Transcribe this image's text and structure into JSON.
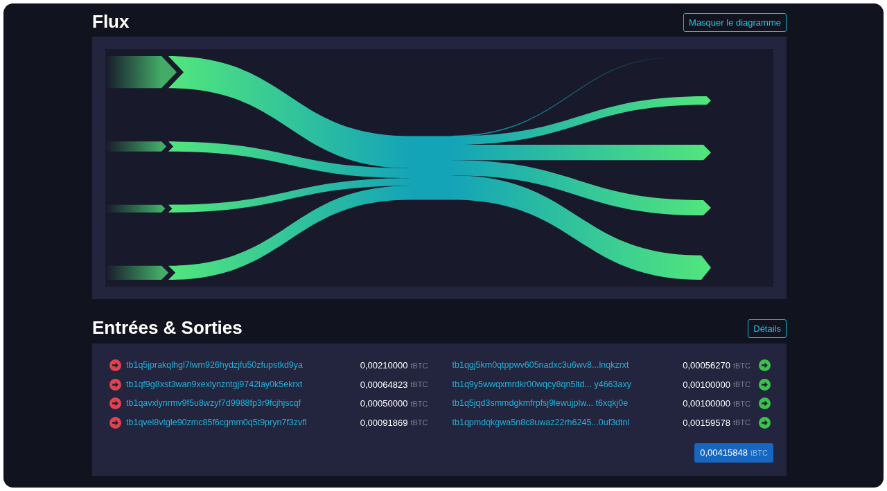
{
  "flow_section": {
    "title": "Flux",
    "toggle_button": "Masquer le diagramme"
  },
  "io_section": {
    "title": "Entrées & Sorties",
    "details_button": "Détails",
    "inputs": [
      {
        "address": "tb1q5jprakqlhgl7lwm926hydzjfu50zfupstkd9ya",
        "amount": "0,00210000",
        "unit": "tBTC"
      },
      {
        "address": "tb1qf9g8xst3wan9xexlynzntgj9742lay0k5ekrxt",
        "amount": "0,00064823",
        "unit": "tBTC"
      },
      {
        "address": "tb1qavxlynrmv9f5u8wzyf7d9988fp3r9fcjhjscqf",
        "amount": "0,00050000",
        "unit": "tBTC"
      },
      {
        "address": "tb1qvel8vtgle90zmc85f6cgmm0q5t9pryn7f3zvfl",
        "amount": "0,00091869",
        "unit": "tBTC"
      }
    ],
    "outputs": [
      {
        "address": "tb1qgj5km0qtppwv605nadxc3u6wv8...lnqkzrxt",
        "amount": "0,00056270",
        "unit": "tBTC"
      },
      {
        "address": "tb1q9y5wwqxmrdkr00wqcy8qn5ltd... y4663axy",
        "amount": "0,00100000",
        "unit": "tBTC"
      },
      {
        "address": "tb1q5jqd3smmdgkmfrpfsj9lewujplw... t6xqkj0e",
        "amount": "0,00100000",
        "unit": "tBTC"
      },
      {
        "address": "tb1qpmdqkgwa5n8c8uwaz22rh6245...0uf3dtnl",
        "amount": "0,00159578",
        "unit": "tBTC"
      }
    ],
    "total": {
      "amount": "0,00415848",
      "unit": "tBTC"
    }
  }
}
